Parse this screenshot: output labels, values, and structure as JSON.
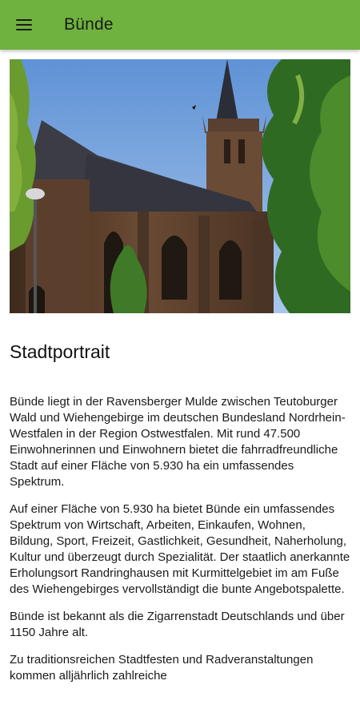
{
  "appbar": {
    "title": "Bünde",
    "menu_icon": "hamburger-menu-icon",
    "background": "#6fb23f"
  },
  "hero": {
    "image": "church-photo"
  },
  "article": {
    "title": "Stadtportrait",
    "paragraphs": [
      "Bünde liegt in der Ravensberger Mulde zwischen Teutoburger Wald und Wiehengebirge im deutschen Bundesland Nordrhein-Westfalen in der Region Ostwestfalen. Mit rund 47.500 Einwohnerinnen und Einwohnern bietet die fahrradfreundliche Stadt auf einer Fläche von 5.930 ha ein umfassendes Spektrum.",
      "Auf einer Fläche von 5.930 ha bietet Bünde ein umfassendes Spektrum von Wirtschaft, Arbeiten, Einkaufen, Wohnen, Bildung, Sport, Freizeit, Gastlichkeit, Gesundheit, Naherholung, Kultur und überzeugt durch Spezialität. Der staatlich anerkannte Erholungsort Randringhausen mit Kurmittelgebiet im am Fuße des Wiehengebirges vervollständigt die bunte Angebotspalette.",
      "Bünde ist bekannt als die Zigarrenstadt Deutschlands und über 1150 Jahre alt.",
      "Zu traditionsreichen Stadtfesten und Radveranstaltungen kommen alljährlich zahlreiche"
    ]
  }
}
